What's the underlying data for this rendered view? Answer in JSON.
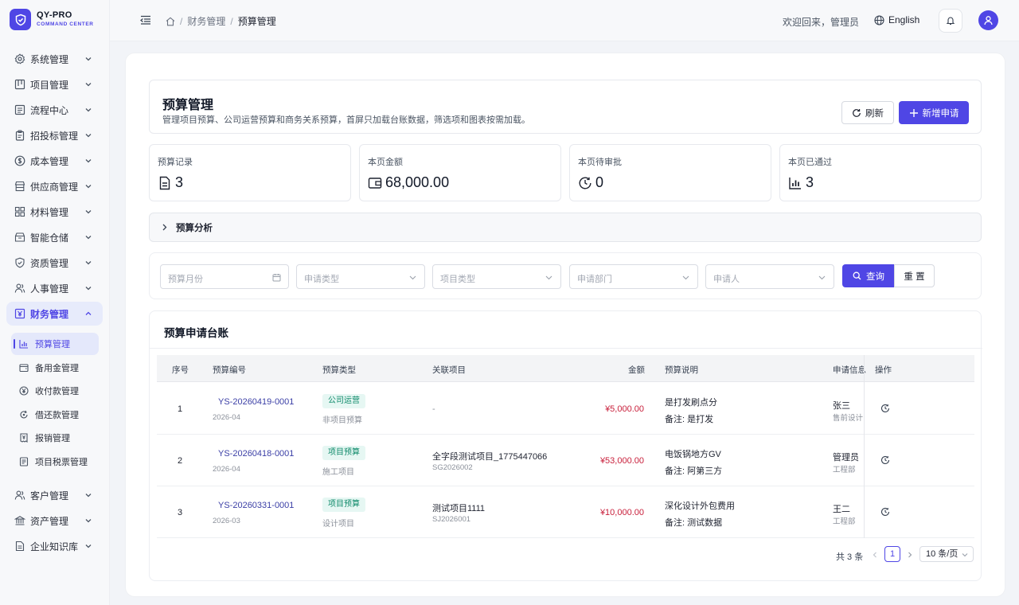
{
  "brand": {
    "title": "QY-PRO",
    "subtitle": "COMMAND CENTER"
  },
  "sidebar": {
    "items": [
      {
        "label": "系统管理",
        "icon": "gear-icon"
      },
      {
        "label": "项目管理",
        "icon": "kanban-icon"
      },
      {
        "label": "流程中心",
        "icon": "flow-icon"
      },
      {
        "label": "招投标管理",
        "icon": "clipboard-icon"
      },
      {
        "label": "成本管理",
        "icon": "dollar-circle-icon"
      },
      {
        "label": "供应商管理",
        "icon": "store-icon"
      },
      {
        "label": "材料管理",
        "icon": "grid-icon"
      },
      {
        "label": "智能仓储",
        "icon": "box-icon"
      },
      {
        "label": "资质管理",
        "icon": "shield-check-icon"
      },
      {
        "label": "人事管理",
        "icon": "users-icon"
      },
      {
        "label": "财务管理",
        "icon": "finance-icon"
      },
      {
        "label": "客户管理",
        "icon": "users-icon"
      },
      {
        "label": "资产管理",
        "icon": "bank-icon"
      },
      {
        "label": "企业知识库",
        "icon": "document-icon"
      }
    ],
    "finance_sub": [
      {
        "label": "预算管理",
        "icon": "bar-chart-icon"
      },
      {
        "label": "备用金管理",
        "icon": "wallet-icon"
      },
      {
        "label": "收付款管理",
        "icon": "yen-circle-icon"
      },
      {
        "label": "借还款管理",
        "icon": "loop-icon"
      },
      {
        "label": "报销管理",
        "icon": "receipt-icon"
      },
      {
        "label": "项目税票管理",
        "icon": "invoice-icon"
      }
    ]
  },
  "header": {
    "breadcrumb": [
      "财务管理",
      "预算管理"
    ],
    "welcome": "欢迎回来，管理员",
    "language": "English"
  },
  "page": {
    "title": "预算管理",
    "description": "管理项目预算、公司运营预算和商务关系预算，首屏只加载台账数据，筛选项和图表按需加载。",
    "refresh_label": "刷新",
    "add_label": "新增申请"
  },
  "stats": [
    {
      "label": "预算记录",
      "value": "3",
      "icon": "document-icon"
    },
    {
      "label": "本页金额",
      "value": "68,000.00",
      "icon": "wallet-icon"
    },
    {
      "label": "本页待审批",
      "value": "0",
      "icon": "clock-icon"
    },
    {
      "label": "本页已通过",
      "value": "3",
      "icon": "bar-chart-icon"
    }
  ],
  "analysis": {
    "label": "预算分析"
  },
  "filters": {
    "month_placeholder": "预算月份",
    "type_placeholder": "申请类型",
    "project_type_placeholder": "项目类型",
    "dept_placeholder": "申请部门",
    "applicant_placeholder": "申请人",
    "query_label": "查询",
    "reset_label": "重 置"
  },
  "table": {
    "title": "预算申请台账",
    "headers": [
      "序号",
      "预算编号",
      "预算类型",
      "关联项目",
      "金额",
      "预算说明",
      "申请信息",
      "操作"
    ],
    "rows": [
      {
        "index": "1",
        "code": "YS-20260419-0001",
        "month": "2026-04",
        "tag": "公司运营",
        "sub_type": "非项目预算",
        "project": "-",
        "project_code": "",
        "amount": "¥5,000.00",
        "desc": "是打发刷点分",
        "note": "备注: 是打发",
        "applicant": "张三",
        "dept": "售前设计"
      },
      {
        "index": "2",
        "code": "YS-20260418-0001",
        "month": "2026-04",
        "tag": "项目预算",
        "sub_type": "施工项目",
        "project": "全字段测试项目_1775447066",
        "project_code": "SG2026002",
        "amount": "¥53,000.00",
        "desc": "电饭锅地方GV",
        "note": "备注: 阿第三方",
        "applicant": "管理员",
        "dept": "工程部"
      },
      {
        "index": "3",
        "code": "YS-20260331-0001",
        "month": "2026-03",
        "tag": "项目预算",
        "sub_type": "设计项目",
        "project": "测试项目1111",
        "project_code": "SJ2026001",
        "amount": "¥10,000.00",
        "desc": "深化设计外包费用",
        "note": "备注: 测试数据",
        "applicant": "王二",
        "dept": "工程部"
      }
    ]
  },
  "pagination": {
    "total": "共 3 条",
    "current": "1",
    "page_size": "10 条/页"
  },
  "colors": {
    "accent": "#4f46e5",
    "amount": "#c81e3a",
    "tag_bg": "#e6f7f3",
    "tag_text": "#0f8a6a"
  }
}
